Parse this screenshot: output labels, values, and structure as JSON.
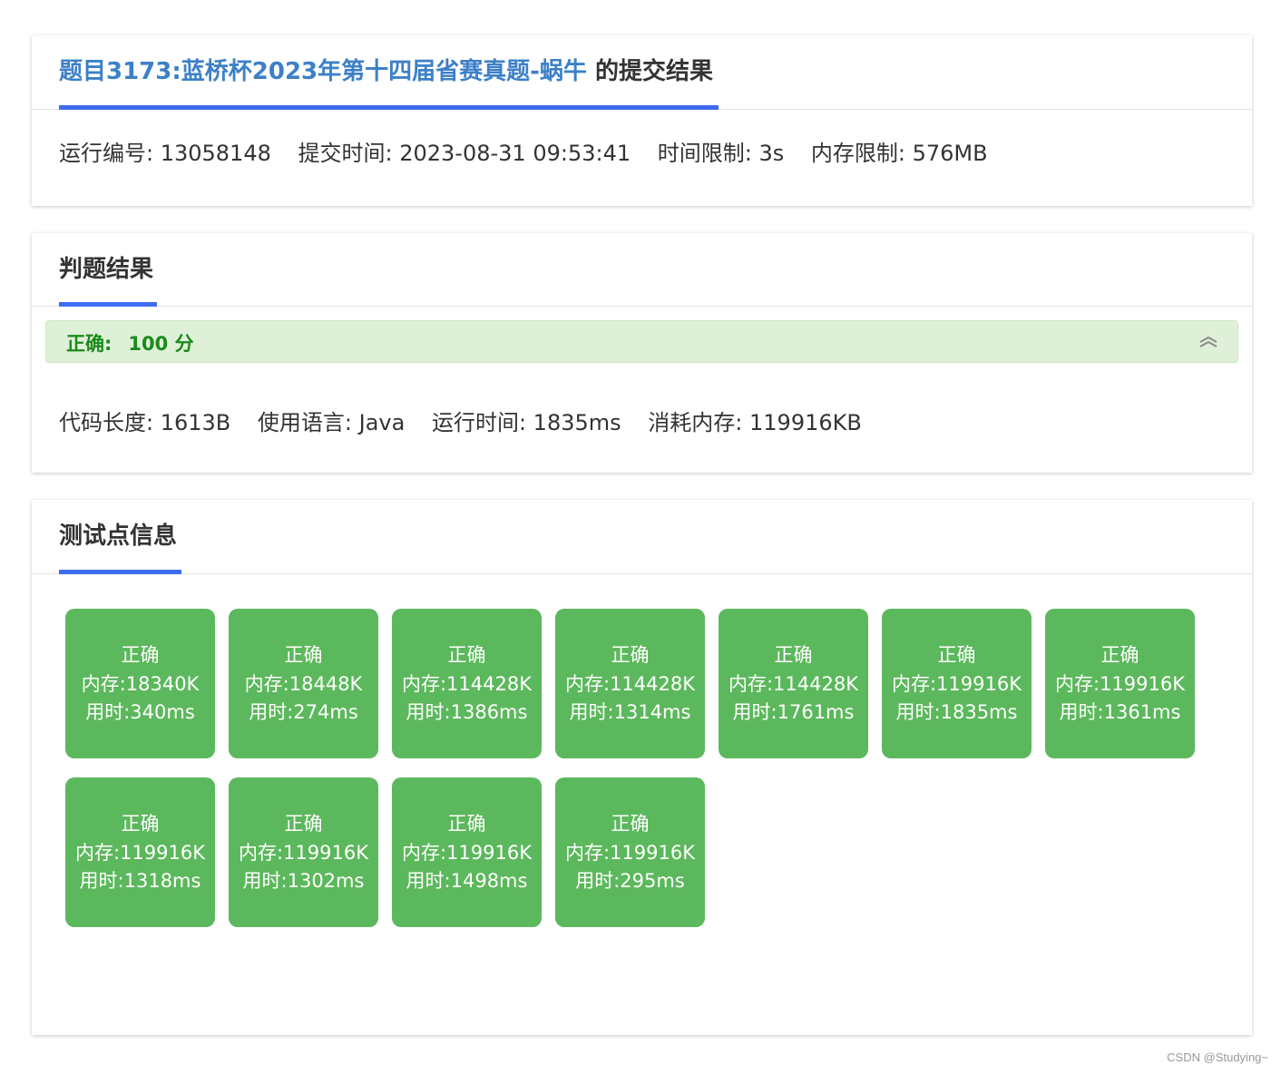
{
  "header": {
    "problem_link": "题目3173:蓝桥杯2023年第十四届省赛真题-蜗牛",
    "title_suffix": " 的提交结果",
    "run_id": "运行编号: 13058148",
    "submit_time": "提交时间: 2023-08-31 09:53:41",
    "time_limit": "时间限制: 3s",
    "memory_limit": "内存限制: 576MB"
  },
  "judge": {
    "section_title": "判题结果",
    "status_label": "正确:",
    "score": "100 分",
    "code_length": "代码长度: 1613B",
    "language": "使用语言: Java",
    "run_time": "运行时间: 1835ms",
    "memory_used": "消耗内存: 119916KB",
    "status_color": "#1a8a1a",
    "status_bg": "#dff0d8",
    "collapse_icon": "chevron-double-up-icon"
  },
  "testcases": {
    "section_title": "测试点信息",
    "accent_color": "#5cb85c",
    "items": [
      {
        "status": "正确",
        "memory": "内存:18340K",
        "time": "用时:340ms"
      },
      {
        "status": "正确",
        "memory": "内存:18448K",
        "time": "用时:274ms"
      },
      {
        "status": "正确",
        "memory": "内存:114428K",
        "time": "用时:1386ms"
      },
      {
        "status": "正确",
        "memory": "内存:114428K",
        "time": "用时:1314ms"
      },
      {
        "status": "正确",
        "memory": "内存:114428K",
        "time": "用时:1761ms"
      },
      {
        "status": "正确",
        "memory": "内存:119916K",
        "time": "用时:1835ms"
      },
      {
        "status": "正确",
        "memory": "内存:119916K",
        "time": "用时:1361ms"
      },
      {
        "status": "正确",
        "memory": "内存:119916K",
        "time": "用时:1318ms"
      },
      {
        "status": "正确",
        "memory": "内存:119916K",
        "time": "用时:1302ms"
      },
      {
        "status": "正确",
        "memory": "内存:119916K",
        "time": "用时:1498ms"
      },
      {
        "status": "正确",
        "memory": "内存:119916K",
        "time": "用时:295ms"
      }
    ]
  },
  "watermark": "CSDN @Studying~",
  "accent_color": "#3d6cf2",
  "link_color": "#3d80c8"
}
